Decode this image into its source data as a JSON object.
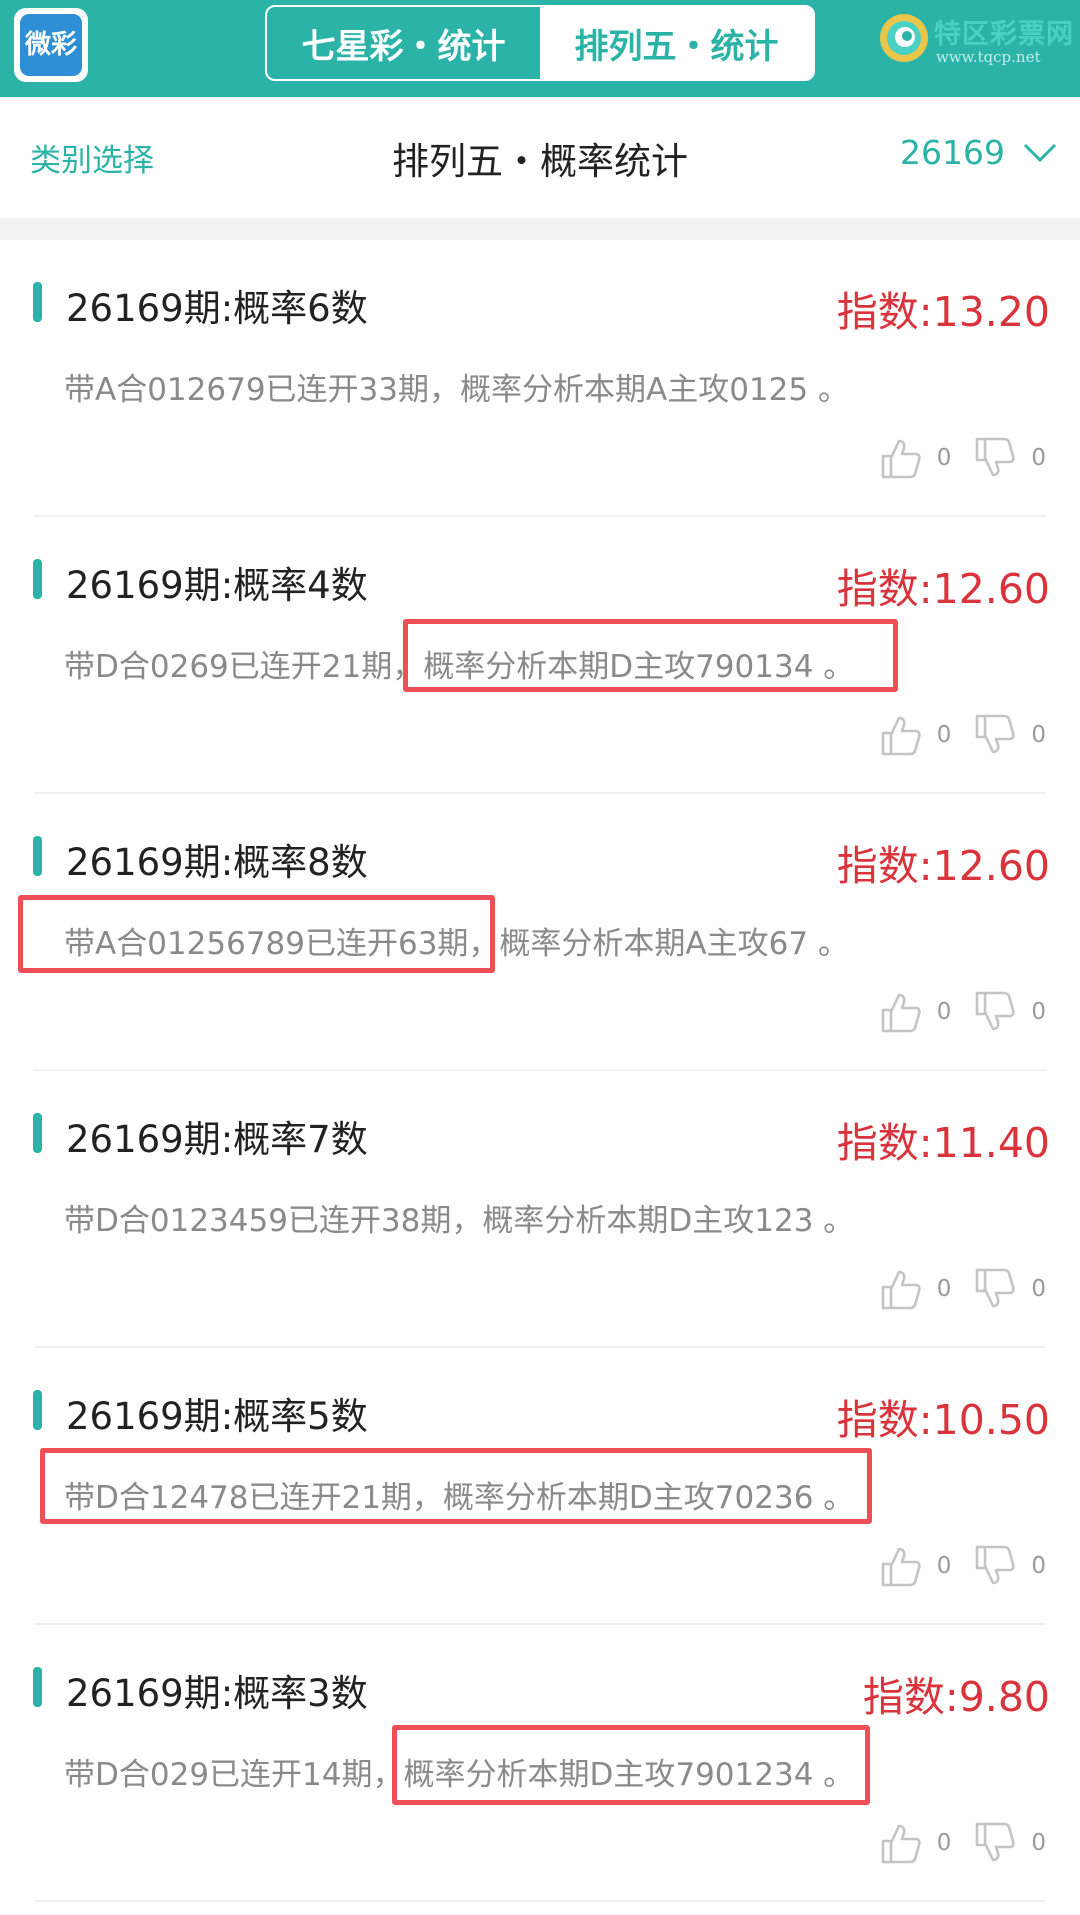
{
  "header": {
    "logo_text": "微彩",
    "tabs": [
      {
        "label": "七星彩・统计",
        "active": false
      },
      {
        "label": "排列五・统计",
        "active": true
      }
    ],
    "brand_name": "特区彩票网",
    "brand_url": "www.tqcp.net"
  },
  "subheader": {
    "category_label": "类别选择",
    "title": "排列五・概率统计",
    "issue": "26169"
  },
  "colors": {
    "accent": "#2cb3a8",
    "index_red": "#d9333b",
    "highlight_box": "#ef4f57"
  },
  "cards": [
    {
      "title": "26169期:概率6数",
      "index": "指数:13.20",
      "desc": "带A合012679已连开33期，概率分析本期A主攻0125 。",
      "likes": "0",
      "dislikes": "0"
    },
    {
      "title": "26169期:概率4数",
      "index": "指数:12.60",
      "desc": "带D合0269已连开21期，概率分析本期D主攻790134 。",
      "likes": "0",
      "dislikes": "0"
    },
    {
      "title": "26169期:概率8数",
      "index": "指数:12.60",
      "desc": "带A合01256789已连开63期，概率分析本期A主攻67 。",
      "likes": "0",
      "dislikes": "0"
    },
    {
      "title": "26169期:概率7数",
      "index": "指数:11.40",
      "desc": "带D合0123459已连开38期，概率分析本期D主攻123 。",
      "likes": "0",
      "dislikes": "0"
    },
    {
      "title": "26169期:概率5数",
      "index": "指数:10.50",
      "desc": "带D合12478已连开21期，概率分析本期D主攻70236 。",
      "likes": "0",
      "dislikes": "0"
    },
    {
      "title": "26169期:概率3数",
      "index": "指数:9.80",
      "desc": "带D合029已连开14期，概率分析本期D主攻7901234 。",
      "likes": "0",
      "dislikes": "0"
    }
  ]
}
